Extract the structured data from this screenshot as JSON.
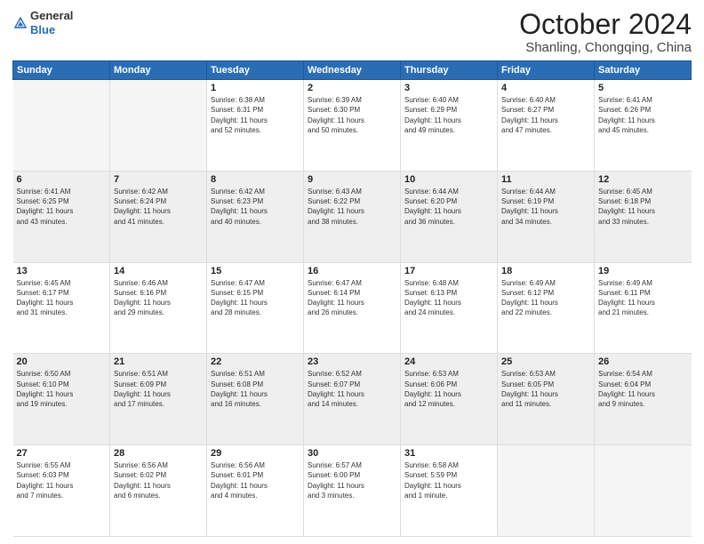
{
  "logo": {
    "line1": "General",
    "line2": "Blue"
  },
  "title": "October 2024",
  "location": "Shanling, Chongqing, China",
  "weekdays": [
    "Sunday",
    "Monday",
    "Tuesday",
    "Wednesday",
    "Thursday",
    "Friday",
    "Saturday"
  ],
  "weeks": [
    [
      {
        "day": "",
        "info": ""
      },
      {
        "day": "",
        "info": ""
      },
      {
        "day": "1",
        "info": "Sunrise: 6:38 AM\nSunset: 6:31 PM\nDaylight: 11 hours\nand 52 minutes."
      },
      {
        "day": "2",
        "info": "Sunrise: 6:39 AM\nSunset: 6:30 PM\nDaylight: 11 hours\nand 50 minutes."
      },
      {
        "day": "3",
        "info": "Sunrise: 6:40 AM\nSunset: 6:29 PM\nDaylight: 11 hours\nand 49 minutes."
      },
      {
        "day": "4",
        "info": "Sunrise: 6:40 AM\nSunset: 6:27 PM\nDaylight: 11 hours\nand 47 minutes."
      },
      {
        "day": "5",
        "info": "Sunrise: 6:41 AM\nSunset: 6:26 PM\nDaylight: 11 hours\nand 45 minutes."
      }
    ],
    [
      {
        "day": "6",
        "info": "Sunrise: 6:41 AM\nSunset: 6:25 PM\nDaylight: 11 hours\nand 43 minutes."
      },
      {
        "day": "7",
        "info": "Sunrise: 6:42 AM\nSunset: 6:24 PM\nDaylight: 11 hours\nand 41 minutes."
      },
      {
        "day": "8",
        "info": "Sunrise: 6:42 AM\nSunset: 6:23 PM\nDaylight: 11 hours\nand 40 minutes."
      },
      {
        "day": "9",
        "info": "Sunrise: 6:43 AM\nSunset: 6:22 PM\nDaylight: 11 hours\nand 38 minutes."
      },
      {
        "day": "10",
        "info": "Sunrise: 6:44 AM\nSunset: 6:20 PM\nDaylight: 11 hours\nand 36 minutes."
      },
      {
        "day": "11",
        "info": "Sunrise: 6:44 AM\nSunset: 6:19 PM\nDaylight: 11 hours\nand 34 minutes."
      },
      {
        "day": "12",
        "info": "Sunrise: 6:45 AM\nSunset: 6:18 PM\nDaylight: 11 hours\nand 33 minutes."
      }
    ],
    [
      {
        "day": "13",
        "info": "Sunrise: 6:45 AM\nSunset: 6:17 PM\nDaylight: 11 hours\nand 31 minutes."
      },
      {
        "day": "14",
        "info": "Sunrise: 6:46 AM\nSunset: 6:16 PM\nDaylight: 11 hours\nand 29 minutes."
      },
      {
        "day": "15",
        "info": "Sunrise: 6:47 AM\nSunset: 6:15 PM\nDaylight: 11 hours\nand 28 minutes."
      },
      {
        "day": "16",
        "info": "Sunrise: 6:47 AM\nSunset: 6:14 PM\nDaylight: 11 hours\nand 26 minutes."
      },
      {
        "day": "17",
        "info": "Sunrise: 6:48 AM\nSunset: 6:13 PM\nDaylight: 11 hours\nand 24 minutes."
      },
      {
        "day": "18",
        "info": "Sunrise: 6:49 AM\nSunset: 6:12 PM\nDaylight: 11 hours\nand 22 minutes."
      },
      {
        "day": "19",
        "info": "Sunrise: 6:49 AM\nSunset: 6:11 PM\nDaylight: 11 hours\nand 21 minutes."
      }
    ],
    [
      {
        "day": "20",
        "info": "Sunrise: 6:50 AM\nSunset: 6:10 PM\nDaylight: 11 hours\nand 19 minutes."
      },
      {
        "day": "21",
        "info": "Sunrise: 6:51 AM\nSunset: 6:09 PM\nDaylight: 11 hours\nand 17 minutes."
      },
      {
        "day": "22",
        "info": "Sunrise: 6:51 AM\nSunset: 6:08 PM\nDaylight: 11 hours\nand 16 minutes."
      },
      {
        "day": "23",
        "info": "Sunrise: 6:52 AM\nSunset: 6:07 PM\nDaylight: 11 hours\nand 14 minutes."
      },
      {
        "day": "24",
        "info": "Sunrise: 6:53 AM\nSunset: 6:06 PM\nDaylight: 11 hours\nand 12 minutes."
      },
      {
        "day": "25",
        "info": "Sunrise: 6:53 AM\nSunset: 6:05 PM\nDaylight: 11 hours\nand 11 minutes."
      },
      {
        "day": "26",
        "info": "Sunrise: 6:54 AM\nSunset: 6:04 PM\nDaylight: 11 hours\nand 9 minutes."
      }
    ],
    [
      {
        "day": "27",
        "info": "Sunrise: 6:55 AM\nSunset: 6:03 PM\nDaylight: 11 hours\nand 7 minutes."
      },
      {
        "day": "28",
        "info": "Sunrise: 6:56 AM\nSunset: 6:02 PM\nDaylight: 11 hours\nand 6 minutes."
      },
      {
        "day": "29",
        "info": "Sunrise: 6:56 AM\nSunset: 6:01 PM\nDaylight: 11 hours\nand 4 minutes."
      },
      {
        "day": "30",
        "info": "Sunrise: 6:57 AM\nSunset: 6:00 PM\nDaylight: 11 hours\nand 3 minutes."
      },
      {
        "day": "31",
        "info": "Sunrise: 6:58 AM\nSunset: 5:59 PM\nDaylight: 11 hours\nand 1 minute."
      },
      {
        "day": "",
        "info": ""
      },
      {
        "day": "",
        "info": ""
      }
    ]
  ]
}
